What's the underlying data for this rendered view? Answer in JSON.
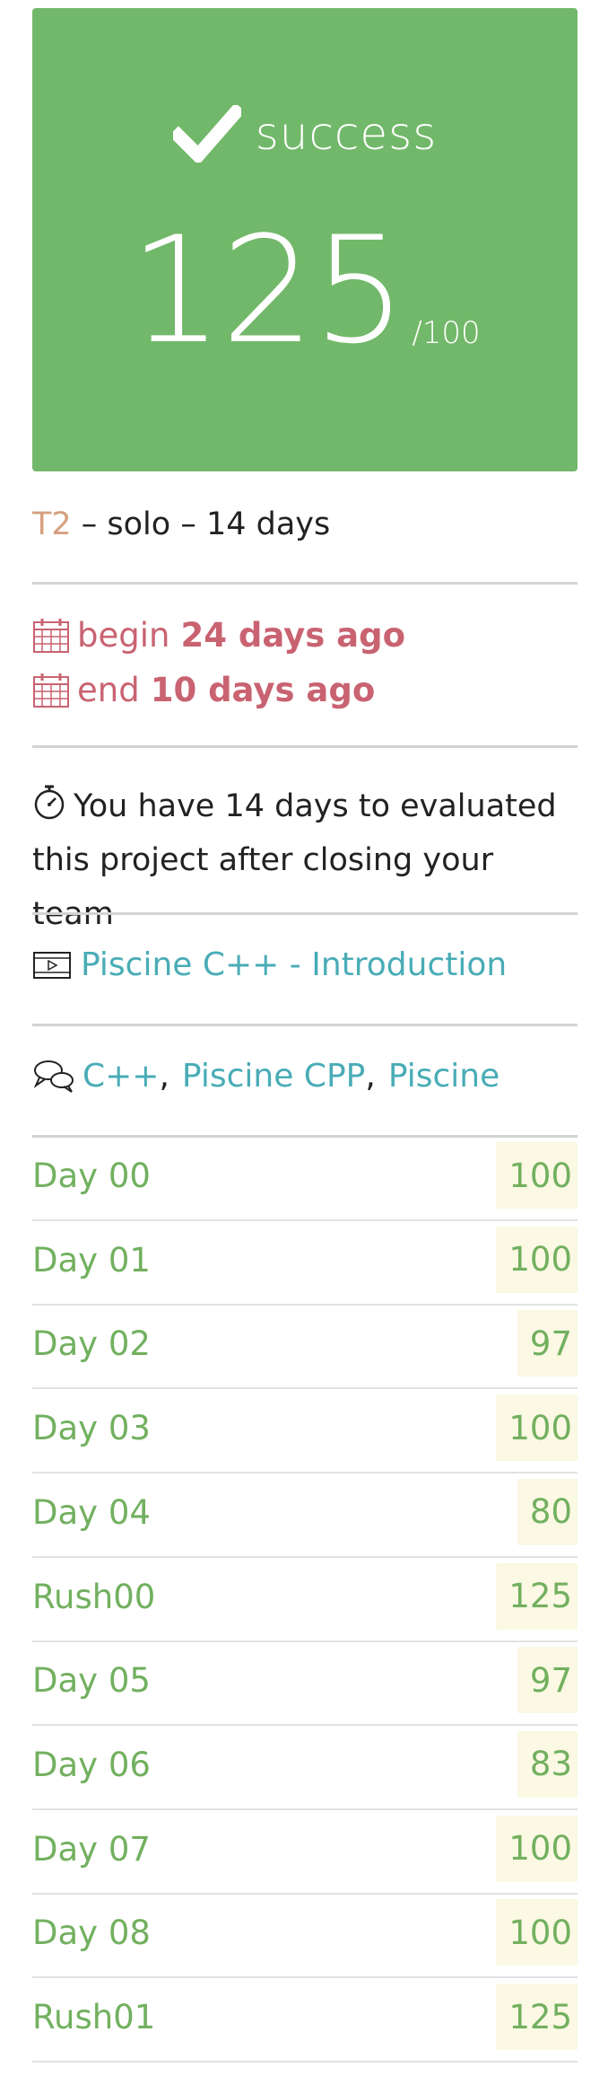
{
  "hero": {
    "status": "success",
    "score": "125",
    "max": "/100",
    "accent": "#72b86a"
  },
  "meta": {
    "tier": "T2",
    "details": " – solo – 14 days"
  },
  "dates": {
    "begin_label": "begin",
    "begin_value": "24 days ago",
    "end_label": "end",
    "end_value": "10 days ago"
  },
  "notice": {
    "text": "You have 14 days to evaluated this project after closing your team"
  },
  "video": {
    "label": "Piscine C++ - Introduction"
  },
  "tags": [
    "C++",
    "Piscine CPP",
    "Piscine"
  ],
  "projects": [
    {
      "name": "Day 00",
      "score": "100"
    },
    {
      "name": "Day 01",
      "score": "100"
    },
    {
      "name": "Day 02",
      "score": "97"
    },
    {
      "name": "Day 03",
      "score": "100"
    },
    {
      "name": "Day 04",
      "score": "80"
    },
    {
      "name": "Rush00",
      "score": "125"
    },
    {
      "name": "Day 05",
      "score": "97"
    },
    {
      "name": "Day 06",
      "score": "83"
    },
    {
      "name": "Day 07",
      "score": "100"
    },
    {
      "name": "Day 08",
      "score": "100"
    },
    {
      "name": "Rush01",
      "score": "125"
    }
  ]
}
